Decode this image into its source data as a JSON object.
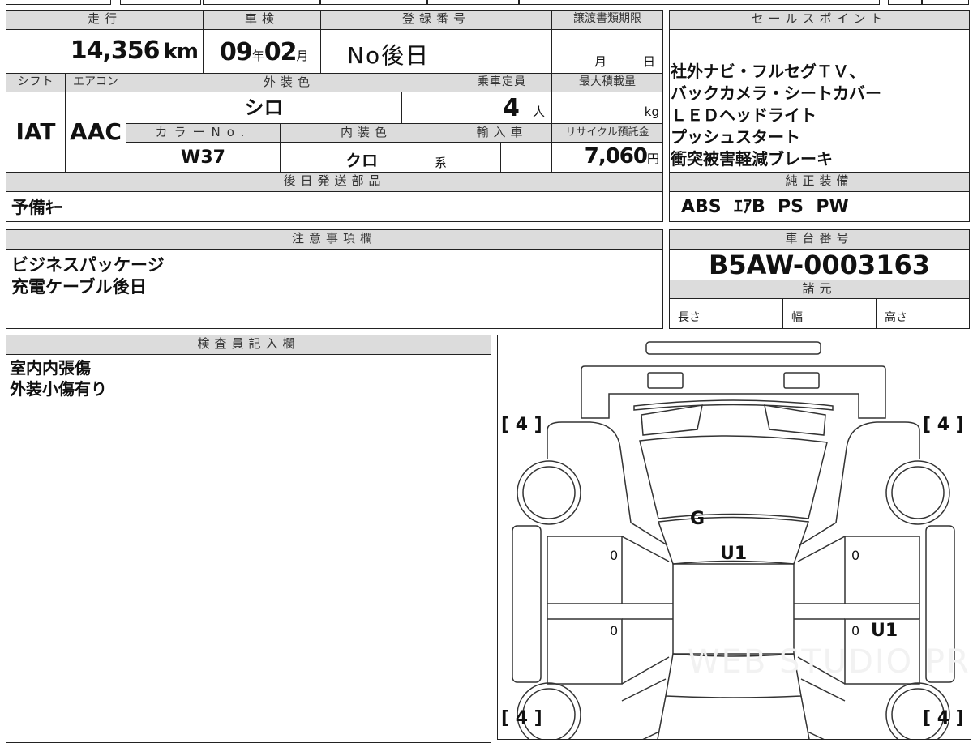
{
  "main_table": {
    "mileage": {
      "label": "走行",
      "value": "14,356",
      "unit": "km"
    },
    "inspection": {
      "label": "車検",
      "year": "09",
      "year_unit": "年",
      "month": "02",
      "month_unit": "月"
    },
    "registration": {
      "label": "登録番号",
      "value": "No後日"
    },
    "transfer_deadline": {
      "label": "譲渡書類期限",
      "month_unit": "月",
      "day_unit": "日"
    },
    "shift": {
      "label": "シフト",
      "value": "IAT"
    },
    "aircon": {
      "label": "エアコン",
      "value": "AAC"
    },
    "exterior_color": {
      "label": "外装色",
      "value": "シロ"
    },
    "capacity": {
      "label": "乗車定員",
      "value": "4",
      "unit": "人"
    },
    "max_load": {
      "label": "最大積載量",
      "unit": "kg"
    },
    "color_no": {
      "label": "カラーNo.",
      "value": "W37"
    },
    "interior_color": {
      "label": "内装色",
      "value": "クロ",
      "suffix": "系"
    },
    "import": {
      "label": "輸入車"
    },
    "recycle_fee": {
      "label": "リサイクル預託金",
      "value": "7,060",
      "unit": "円"
    },
    "later_parts": {
      "label": "後日発送部品",
      "value": "予備ｷｰ"
    }
  },
  "sales_points": {
    "label": "セールスポイント",
    "lines": [
      "社外ナビ・フルセグＴＶ、",
      "バックカメラ・シートカバー",
      "ＬＥＤヘッドライト",
      "プッシュスタート",
      "衝突被害軽減ブレーキ"
    ]
  },
  "standard_equipment": {
    "label": "純正装備",
    "value": "ABS  ｴｱB  PS  PW"
  },
  "notes": {
    "label": "注意事項欄",
    "lines": [
      "ビジネスパッケージ",
      "充電ケーブル後日"
    ]
  },
  "chassis": {
    "label": "車台番号",
    "value": "B5AW-0003163"
  },
  "specs": {
    "label": "諸元",
    "length": "長さ",
    "width": "幅",
    "height": "高さ"
  },
  "inspector": {
    "label": "検査員記入欄",
    "lines": [
      "室内内張傷",
      "外装小傷有り"
    ]
  },
  "diagram": {
    "tire_marks": [
      "[ 4 ]",
      "[ 4 ]",
      "[ 4 ]",
      "[ 4 ]"
    ],
    "roof_mark": "G",
    "cabin_mark": "U1",
    "door_marks": [
      "0",
      "0",
      "0",
      "0"
    ],
    "rear_right_mark": "U1",
    "watermark": "WEB STUDIO PRO"
  }
}
